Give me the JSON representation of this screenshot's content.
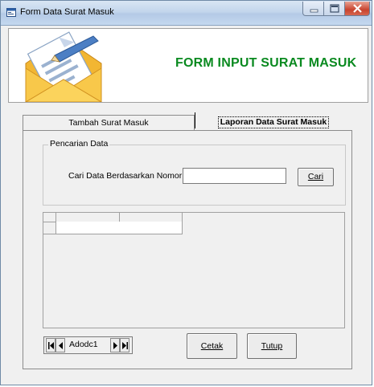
{
  "window": {
    "title": "Form Data Surat Masuk",
    "buttons": [
      "minimize",
      "maximize",
      "close"
    ]
  },
  "header": {
    "title": "FORM INPUT SURAT MASUK",
    "title_color": "#0a8a20"
  },
  "tabs": [
    {
      "label": "Tambah Surat Masuk",
      "active": false
    },
    {
      "label": "Laporan Data Surat Masuk",
      "active": true
    }
  ],
  "search": {
    "group_label": "Pencarian Data",
    "field_label": "Cari Data Berdasarkan Nomor Surat",
    "value": "",
    "button_label": "Cari"
  },
  "grid": {
    "columns": [
      "",
      ""
    ],
    "rows": [
      [
        "",
        ""
      ]
    ]
  },
  "adodc": {
    "caption": "Adodc1"
  },
  "actions": {
    "print_label": "Cetak",
    "close_label": "Tutup"
  }
}
